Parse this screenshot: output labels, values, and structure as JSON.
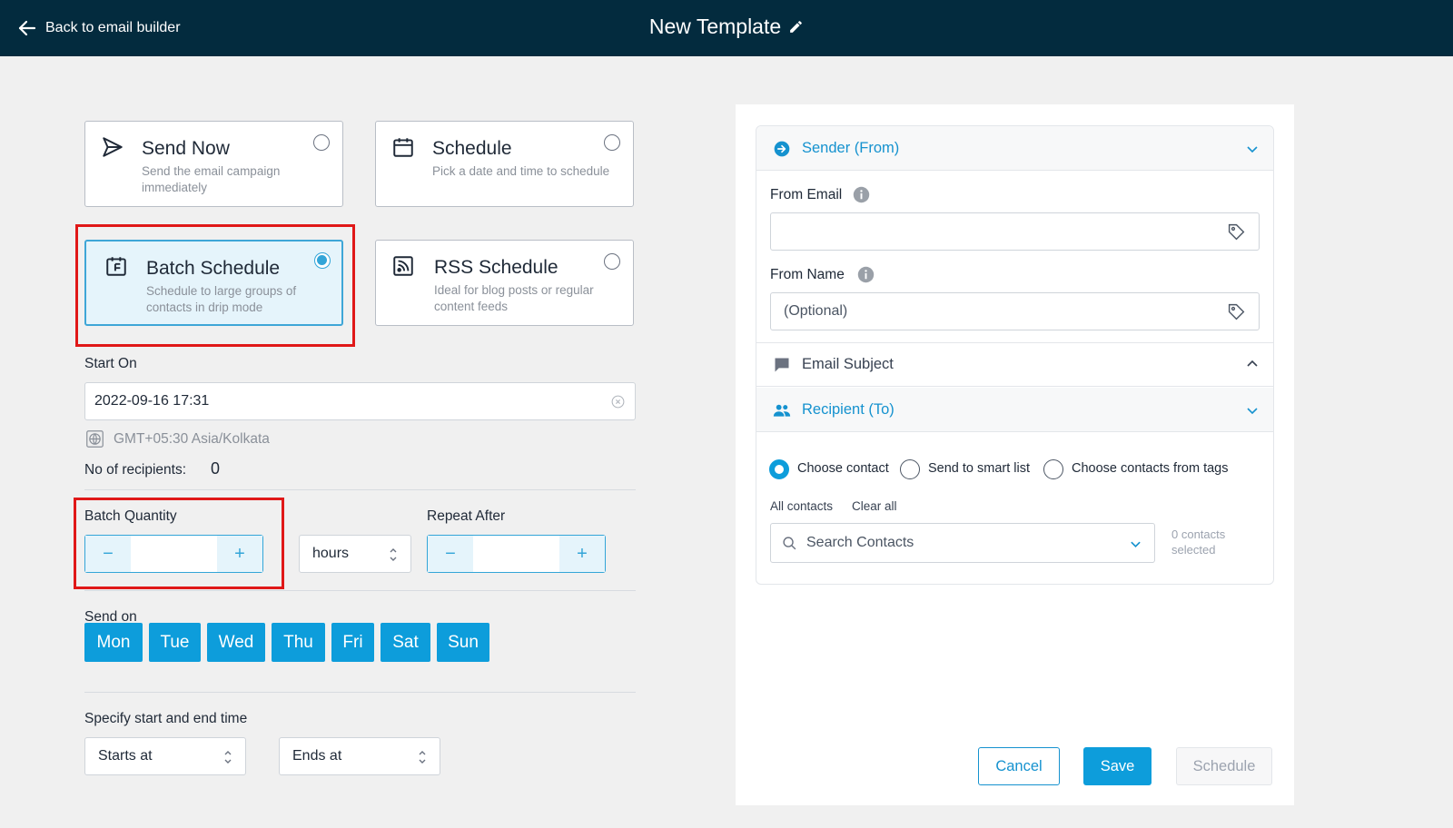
{
  "header": {
    "back_label": "Back to email builder",
    "title": "New Template"
  },
  "options": [
    {
      "title": "Send Now",
      "desc": "Send the email campaign immediately",
      "selected": false
    },
    {
      "title": "Schedule",
      "desc": "Pick a date and time to schedule",
      "selected": false
    },
    {
      "title": "Batch Schedule",
      "desc": "Schedule to large groups of contacts in drip mode",
      "selected": true
    },
    {
      "title": "RSS Schedule",
      "desc": "Ideal for blog posts or regular content feeds",
      "selected": false
    }
  ],
  "start_on": {
    "label": "Start On",
    "value": "2022-09-16 17:31",
    "timezone": "GMT+05:30 Asia/Kolkata"
  },
  "recipients": {
    "label": "No of recipients:",
    "count": "0"
  },
  "batch": {
    "quantity_label": "Batch Quantity",
    "unit": "hours",
    "repeat_label": "Repeat After",
    "minus": "−",
    "plus": "+"
  },
  "send_on": {
    "label": "Send on",
    "days": [
      "Mon",
      "Tue",
      "Wed",
      "Thu",
      "Fri",
      "Sat",
      "Sun"
    ]
  },
  "time_range": {
    "label": "Specify start and end time",
    "start": "Starts at",
    "end": "Ends at"
  },
  "right_panel": {
    "sender": {
      "title": "Sender (From)",
      "from_email_label": "From Email",
      "from_email_value": "",
      "from_name_label": "From Name",
      "from_name_placeholder": "(Optional)"
    },
    "subject": {
      "title": "Email Subject"
    },
    "recipient": {
      "title": "Recipient (To)",
      "choices": [
        "Choose contact",
        "Send to smart list",
        "Choose contacts from tags"
      ],
      "selected": "Choose contact",
      "all_contacts": "All contacts",
      "clear_all": "Clear all",
      "search_placeholder": "Search Contacts",
      "selected_line1": "0 contacts",
      "selected_line2": "selected"
    },
    "buttons": {
      "cancel": "Cancel",
      "save": "Save",
      "schedule": "Schedule"
    }
  },
  "colors": {
    "topbar": "#032b3e",
    "accent": "#0d9ddb",
    "highlight": "#e01818"
  }
}
